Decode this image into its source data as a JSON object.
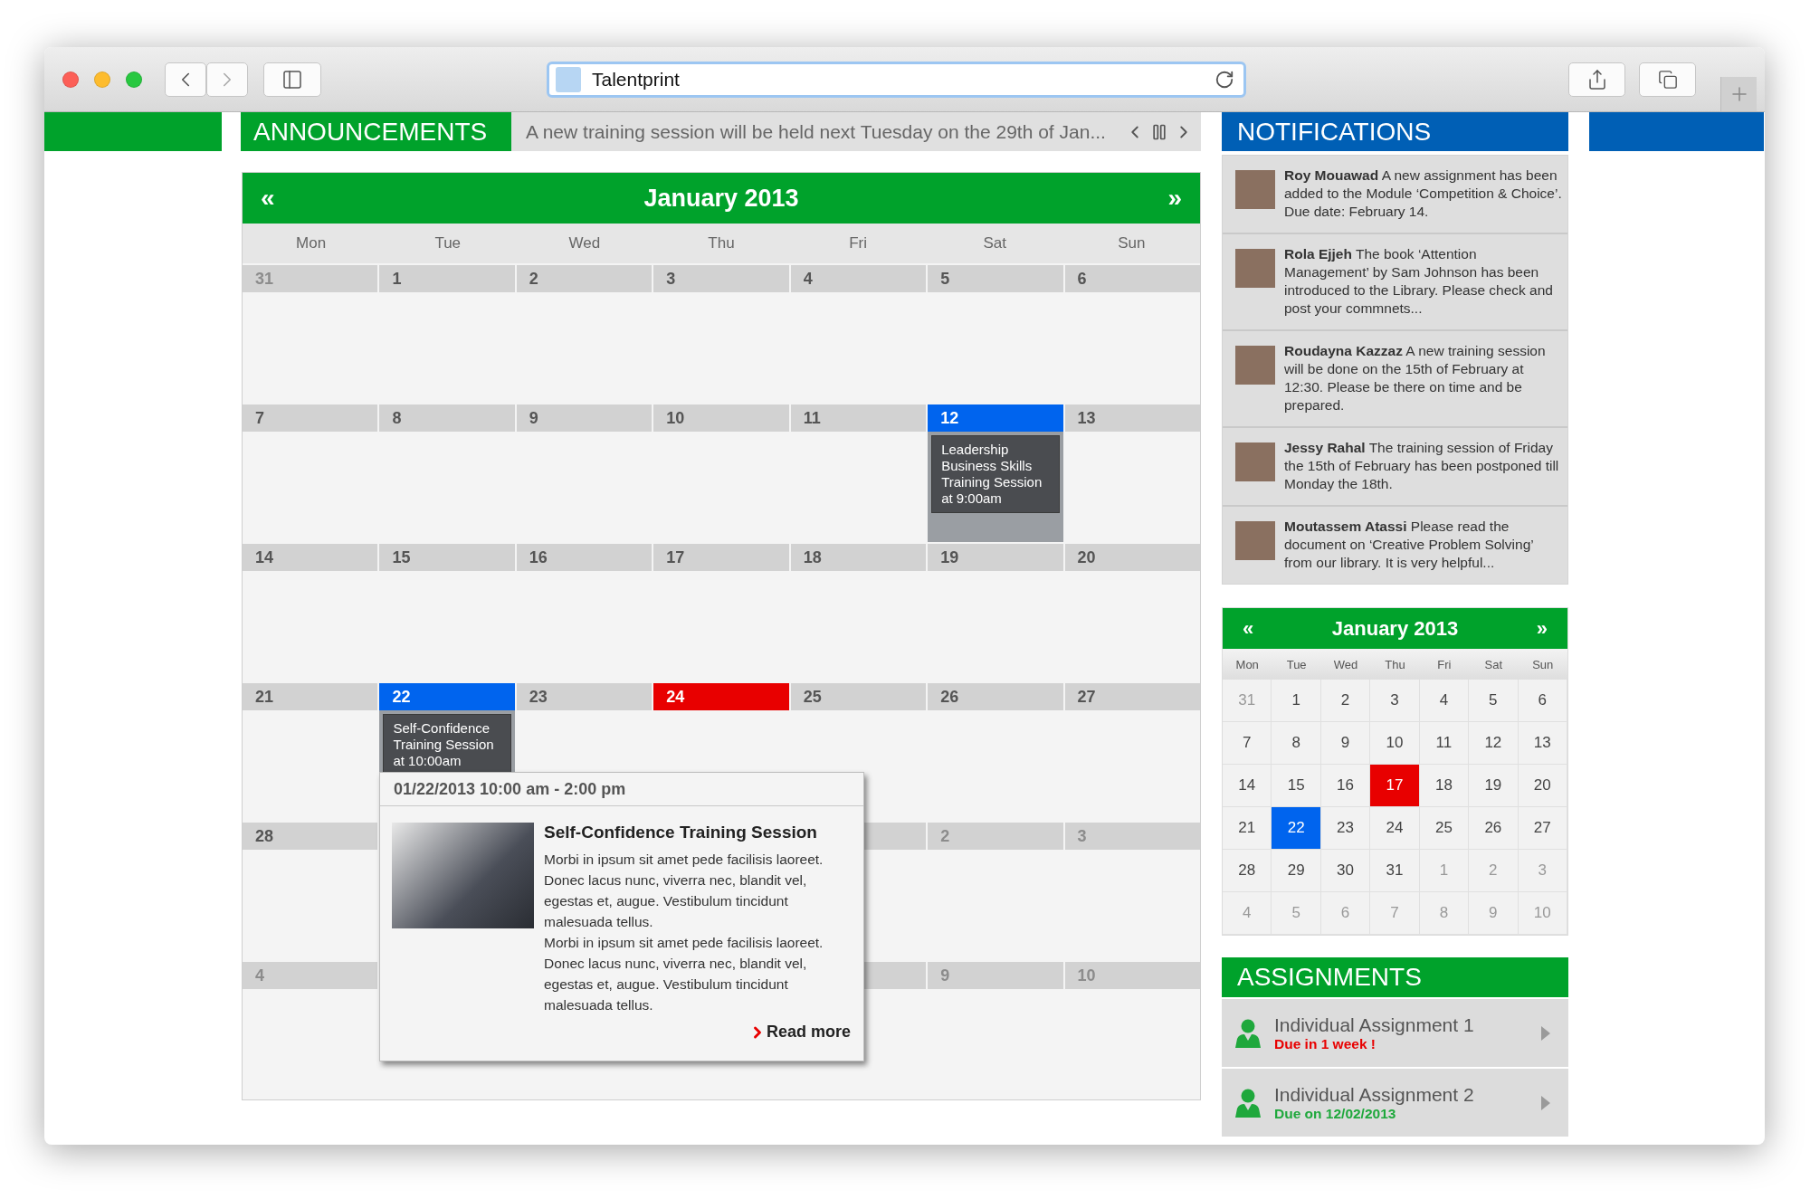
{
  "browser": {
    "tab_title": "Talentprint"
  },
  "announcements": {
    "title": "ANNOUNCEMENTS",
    "text": "A new training session will be held next Tuesday on the 29th of Jan..."
  },
  "notifications": {
    "title": "NOTIFICATIONS",
    "items": [
      {
        "text": "**Roy Mouawad** A new assignment has been added to the Module ‘Competition & Choice’. Due date: February 14."
      },
      {
        "text": "**Rola Ejjeh** The book ‘Attention Management’ by Sam Johnson has been introduced to the Library. Please check and post your commnets..."
      },
      {
        "text": "**Roudayna Kazzaz** A new training session will be done on the 15th of February at 12:30. Please be there on time and be prepared."
      },
      {
        "text": "**Jessy Rahal** The training session of Friday the 15th of February has been postponed till Monday the 18th."
      },
      {
        "text": "**Moutassem Atassi** Please read the document on ‘Creative Problem Solving’ from our library. It is very helpful..."
      }
    ]
  },
  "calendar": {
    "title": "January 2013",
    "prev": "«",
    "next": "»",
    "weekdays": [
      "Mon",
      "Tue",
      "Wed",
      "Thu",
      "Fri",
      "Sat",
      "Sun"
    ],
    "weeks": [
      {
        "days": [
          {
            "label": "31",
            "muted": true,
            "selected": false,
            "today": false
          },
          {
            "label": "1",
            "muted": false,
            "selected": false,
            "today": false
          },
          {
            "label": "2",
            "muted": false,
            "selected": false,
            "today": false
          },
          {
            "label": "3",
            "muted": false,
            "selected": false,
            "today": false
          },
          {
            "label": "4",
            "muted": false,
            "selected": false,
            "today": false
          },
          {
            "label": "5",
            "muted": false,
            "selected": false,
            "today": false
          },
          {
            "label": "6",
            "muted": false,
            "selected": false,
            "today": false
          }
        ]
      },
      {
        "days": [
          {
            "label": "7",
            "muted": false,
            "selected": false,
            "today": false
          },
          {
            "label": "8",
            "muted": false,
            "selected": false,
            "today": false
          },
          {
            "label": "9",
            "muted": false,
            "selected": false,
            "today": false
          },
          {
            "label": "10",
            "muted": false,
            "selected": false,
            "today": false
          },
          {
            "label": "11",
            "muted": false,
            "selected": false,
            "today": false
          },
          {
            "label": "12",
            "muted": false,
            "selected": true,
            "today": false,
            "event": "Leadership Business Skills Training Session at 9:00am"
          },
          {
            "label": "13",
            "muted": false,
            "selected": false,
            "today": false
          }
        ]
      },
      {
        "days": [
          {
            "label": "14",
            "muted": false,
            "selected": false,
            "today": false
          },
          {
            "label": "15",
            "muted": false,
            "selected": false,
            "today": false
          },
          {
            "label": "16",
            "muted": false,
            "selected": false,
            "today": false
          },
          {
            "label": "17",
            "muted": false,
            "selected": false,
            "today": false
          },
          {
            "label": "18",
            "muted": false,
            "selected": false,
            "today": false
          },
          {
            "label": "19",
            "muted": false,
            "selected": false,
            "today": false
          },
          {
            "label": "20",
            "muted": false,
            "selected": false,
            "today": false
          }
        ]
      },
      {
        "days": [
          {
            "label": "21",
            "muted": false,
            "selected": false,
            "today": false
          },
          {
            "label": "22",
            "muted": false,
            "selected": true,
            "today": false,
            "event": "Self-Confidence Training Session at 10:00am"
          },
          {
            "label": "23",
            "muted": false,
            "selected": false,
            "today": false
          },
          {
            "label": "24",
            "muted": false,
            "selected": false,
            "today": true
          },
          {
            "label": "25",
            "muted": false,
            "selected": false,
            "today": false
          },
          {
            "label": "26",
            "muted": false,
            "selected": false,
            "today": false
          },
          {
            "label": "27",
            "muted": false,
            "selected": false,
            "today": false
          }
        ]
      },
      {
        "days": [
          {
            "label": "28",
            "muted": false,
            "selected": false,
            "today": false
          }
        ],
        "days_right": [
          {
            "label": "2",
            "muted": true,
            "selected": false,
            "today": false
          },
          {
            "label": "3",
            "muted": true,
            "selected": false,
            "today": false
          }
        ]
      },
      {
        "days": [
          {
            "label": "4",
            "muted": true,
            "selected": false,
            "today": false
          }
        ],
        "days_right": [
          {
            "label": "9",
            "muted": true,
            "selected": false,
            "today": false
          },
          {
            "label": "10",
            "muted": true,
            "selected": false,
            "today": false
          }
        ]
      }
    ],
    "popup": {
      "date_range": "01/22/2013 10:00 am - 2:00 pm",
      "title": "Self-Confidence Training Session",
      "paragraphs": [
        "Morbi in ipsum sit amet pede facilisis laoreet. Donec lacus nunc, viverra nec, blandit vel, egestas et, augue. Vestibulum tincidunt malesuada tellus.",
        "Morbi in ipsum sit amet pede facilisis laoreet. Donec lacus nunc, viverra nec, blandit vel, egestas et, augue. Vestibulum tincidunt malesuada tellus."
      ],
      "link": "Read more"
    }
  },
  "mini_calendar": {
    "title": "January 2013",
    "prev": "«",
    "next": "»",
    "weekdays": [
      "Mon",
      "Tue",
      "Wed",
      "Thu",
      "Fri",
      "Sat",
      "Sun"
    ],
    "weeks": [
      {
        "days": [
          {
            "label": "31",
            "muted": true,
            "selected": false,
            "today": false
          },
          {
            "label": "1",
            "muted": false,
            "selected": false,
            "today": false
          },
          {
            "label": "2",
            "muted": false,
            "selected": false,
            "today": false
          },
          {
            "label": "3",
            "muted": false,
            "selected": false,
            "today": false
          },
          {
            "label": "4",
            "muted": false,
            "selected": false,
            "today": false
          },
          {
            "label": "5",
            "muted": false,
            "selected": false,
            "today": false
          },
          {
            "label": "6",
            "muted": false,
            "selected": false,
            "today": false
          }
        ]
      },
      {
        "days": [
          {
            "label": "7",
            "muted": false,
            "selected": false,
            "today": false
          },
          {
            "label": "8",
            "muted": false,
            "selected": false,
            "today": false
          },
          {
            "label": "9",
            "muted": false,
            "selected": false,
            "today": false
          },
          {
            "label": "10",
            "muted": false,
            "selected": false,
            "today": false
          },
          {
            "label": "11",
            "muted": false,
            "selected": false,
            "today": false
          },
          {
            "label": "12",
            "muted": false,
            "selected": false,
            "today": false
          },
          {
            "label": "13",
            "muted": false,
            "selected": false,
            "today": false
          }
        ]
      },
      {
        "days": [
          {
            "label": "14",
            "muted": false,
            "selected": false,
            "today": false
          },
          {
            "label": "15",
            "muted": false,
            "selected": false,
            "today": false
          },
          {
            "label": "16",
            "muted": false,
            "selected": false,
            "today": false
          },
          {
            "label": "17",
            "muted": false,
            "selected": false,
            "today": true
          },
          {
            "label": "18",
            "muted": false,
            "selected": false,
            "today": false
          },
          {
            "label": "19",
            "muted": false,
            "selected": false,
            "today": false
          },
          {
            "label": "20",
            "muted": false,
            "selected": false,
            "today": false
          }
        ]
      },
      {
        "days": [
          {
            "label": "21",
            "muted": false,
            "selected": false,
            "today": false
          },
          {
            "label": "22",
            "muted": false,
            "selected": true,
            "today": false
          },
          {
            "label": "23",
            "muted": false,
            "selected": false,
            "today": false
          },
          {
            "label": "24",
            "muted": false,
            "selected": false,
            "today": false
          },
          {
            "label": "25",
            "muted": false,
            "selected": false,
            "today": false
          },
          {
            "label": "26",
            "muted": false,
            "selected": false,
            "today": false
          },
          {
            "label": "27",
            "muted": false,
            "selected": false,
            "today": false
          }
        ]
      },
      {
        "days": [
          {
            "label": "28",
            "muted": false,
            "selected": false,
            "today": false
          },
          {
            "label": "29",
            "muted": false,
            "selected": false,
            "today": false
          },
          {
            "label": "30",
            "muted": false,
            "selected": false,
            "today": false
          },
          {
            "label": "31",
            "muted": false,
            "selected": false,
            "today": false
          },
          {
            "label": "1",
            "muted": true,
            "selected": false,
            "today": false
          },
          {
            "label": "2",
            "muted": true,
            "selected": false,
            "today": false
          },
          {
            "label": "3",
            "muted": true,
            "selected": false,
            "today": false
          }
        ]
      },
      {
        "days": [
          {
            "label": "4",
            "muted": true,
            "selected": false,
            "today": false
          },
          {
            "label": "5",
            "muted": true,
            "selected": false,
            "today": false
          },
          {
            "label": "6",
            "muted": true,
            "selected": false,
            "today": false
          },
          {
            "label": "7",
            "muted": true,
            "selected": false,
            "today": false
          },
          {
            "label": "8",
            "muted": true,
            "selected": false,
            "today": false
          },
          {
            "label": "9",
            "muted": true,
            "selected": false,
            "today": false
          },
          {
            "label": "10",
            "muted": true,
            "selected": false,
            "today": false
          }
        ]
      }
    ]
  },
  "assignments": {
    "title": "ASSIGNMENTS",
    "items": [
      {
        "title": "Individual Assignment 1",
        "due": "Due in 1 week !",
        "kind": "urgent"
      },
      {
        "title": "Individual Assignment 2",
        "due": "Due on 12/02/2013",
        "kind": "scheduled"
      }
    ]
  }
}
